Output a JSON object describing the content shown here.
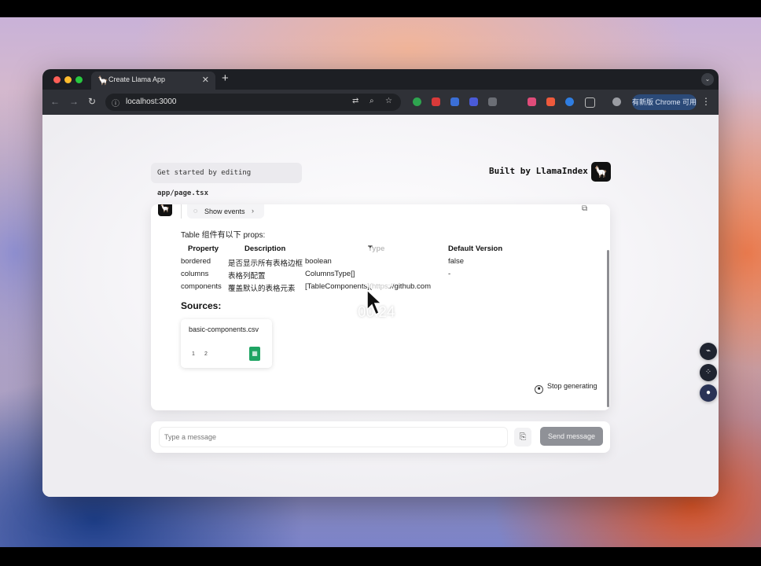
{
  "browser": {
    "tab_title": "Create Llama App",
    "url": "localhost:3000",
    "update_label": "有新版 Chrome 可用"
  },
  "header": {
    "hint_prefix": "Get started by editing ",
    "hint_file": "app/page.tsx",
    "built_by": "Built by LlamaIndex"
  },
  "chat": {
    "show_events_label": "Show events",
    "intro": "Table 组件有以下 props:",
    "table": {
      "headers": [
        "Property",
        "Description",
        "Type",
        "Default Version"
      ],
      "rows": [
        [
          "bordered",
          "是否显示所有表格边框",
          "boolean",
          "false"
        ],
        [
          "columns",
          "表格列配置",
          "ColumnsType[]",
          "-"
        ],
        [
          "components",
          "覆盖默认的表格元素",
          "[TableComponents](https://github.com",
          ""
        ]
      ]
    },
    "sources_heading": "Sources:",
    "source_card": {
      "title": "basic-components.csv",
      "pages": [
        "1",
        "2"
      ]
    },
    "stop_label": "Stop generating"
  },
  "composer": {
    "placeholder": "Type a message",
    "send_label": "Send message"
  },
  "video": {
    "timecode": "00:24"
  },
  "colors": {
    "send_button": "#8f9197",
    "sheet_icon": "#1fa463",
    "browser_chrome": "#2f3137"
  }
}
